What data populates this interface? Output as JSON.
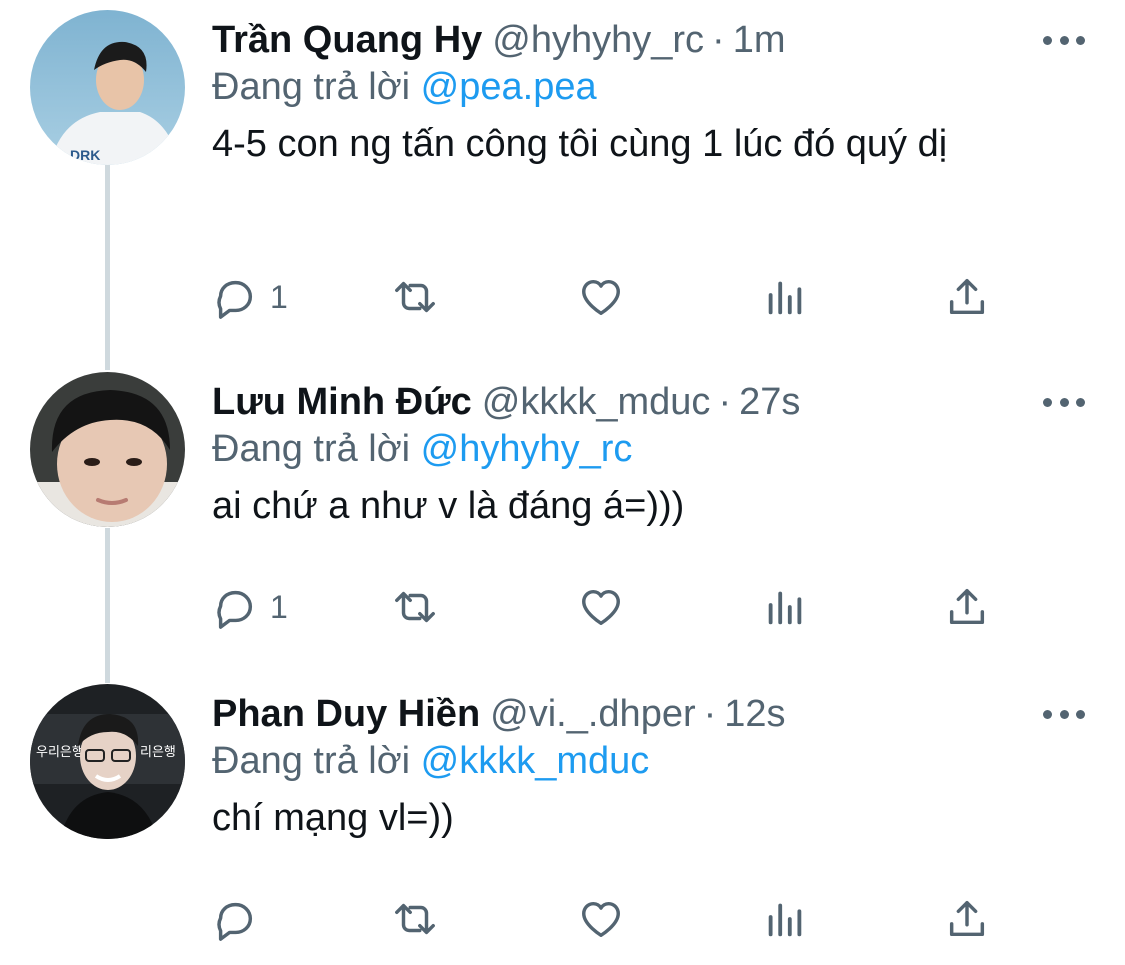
{
  "replying_prefix": "Đang trả lời",
  "tweets": [
    {
      "name": "Trần Quang Hy",
      "handle": "@hyhyhy_rc",
      "separator": "·",
      "time": "1m",
      "reply_to": "@pea.pea",
      "text": "4-5 con ng tấn công tôi cùng 1 lúc đó quý dị",
      "reply_count": "1",
      "avatar": "young man in white t-shirt against blue sky"
    },
    {
      "name": "Lưu Minh Đức",
      "handle": "@kkkk_mduc",
      "separator": "·",
      "time": "27s",
      "reply_to": "@hyhyhy_rc",
      "text": "ai chứ a như v là đáng á=)))",
      "reply_count": "1",
      "avatar": "close-up selfie of young man with black hair"
    },
    {
      "name": "Phan Duy Hiền",
      "handle": "@vi._.dhper",
      "separator": "·",
      "time": "12s",
      "reply_to": "@kkkk_mduc",
      "text": "chí mạng vl=))",
      "reply_count": "",
      "avatar": "esports player with glasses smiling in front of sponsor backdrop"
    }
  ],
  "icons": [
    "reply-icon",
    "retweet-icon",
    "like-icon",
    "views-icon",
    "share-icon",
    "more-icon"
  ],
  "colors": {
    "link": "#1d9bf0",
    "secondary": "#536471",
    "primary": "#0f1419",
    "thread_line": "#cfd9de"
  }
}
